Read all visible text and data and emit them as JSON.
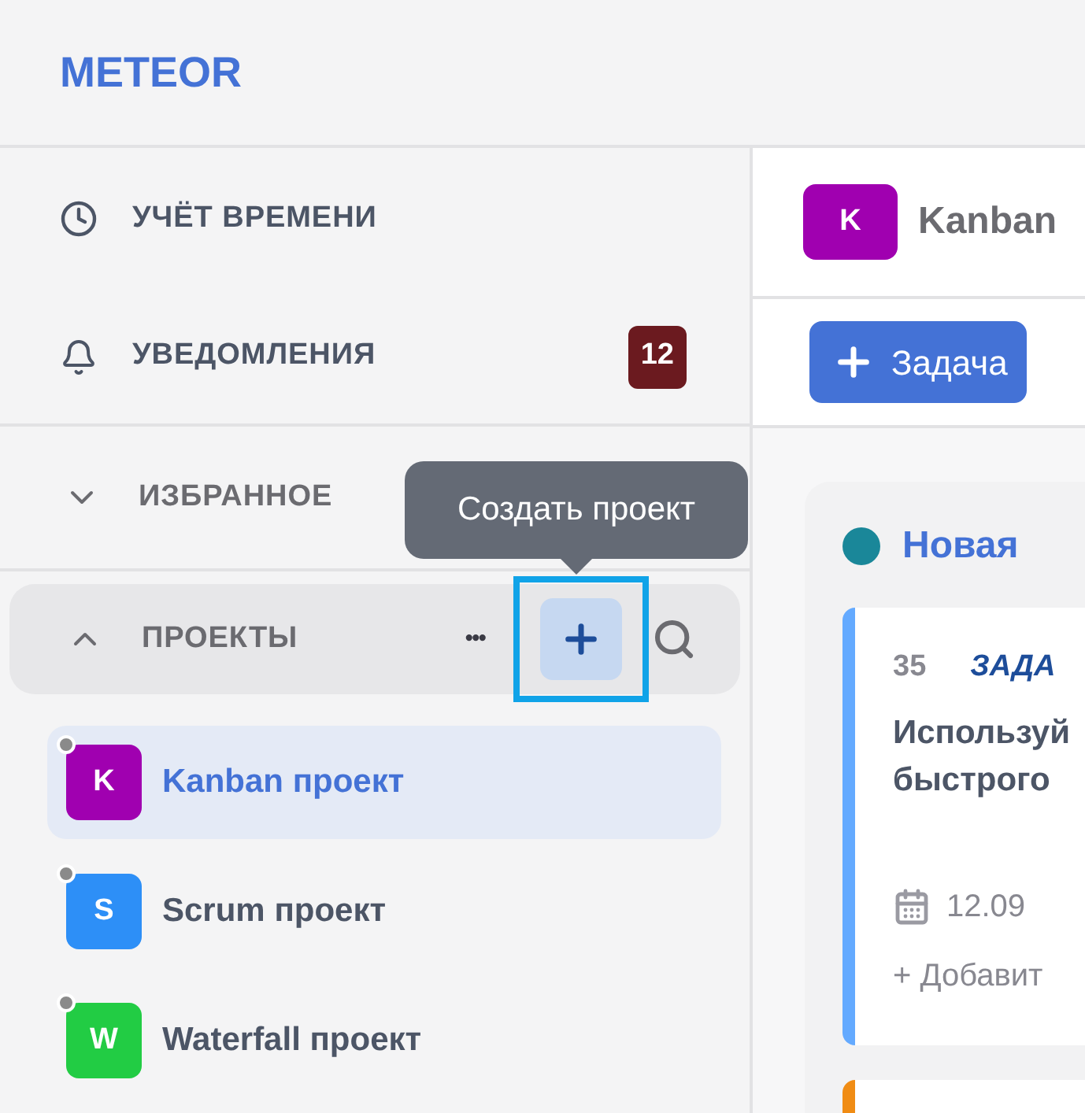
{
  "logo": "METEOR",
  "nav": [
    {
      "kind": "clock",
      "label": "УЧЁТ ВРЕМЕНИ"
    },
    {
      "kind": "bell",
      "label": "УВЕДОМЛЕНИЯ",
      "badge": "12"
    }
  ],
  "favorites": {
    "label": "ИЗБРАННОЕ",
    "expanded": false
  },
  "projects_section": {
    "label": "ПРОЕКТЫ",
    "expanded": true,
    "more": "•••",
    "add_highlighted": true,
    "tooltip": "Создать проект"
  },
  "projects": [
    {
      "initial": "K",
      "name": "Kanban проект",
      "color": "#a000b0",
      "selected": true
    },
    {
      "initial": "S",
      "name": "Scrum проект",
      "color": "#2d8ff7",
      "selected": false
    },
    {
      "initial": "W",
      "name": "Waterfall проект",
      "color": "#22cc44",
      "selected": false
    }
  ],
  "project_header": {
    "initial": "K",
    "title": "Kanban",
    "color": "#a000b0"
  },
  "toolbar": {
    "new_task": "Задача"
  },
  "board": {
    "column": {
      "title": "Новая",
      "color": "#1a8799",
      "cards": [
        {
          "number": "35",
          "type": "ЗАДА",
          "title_lines": [
            "Используй",
            "быстрого"
          ],
          "date": "12.09",
          "add": "+ Добавит",
          "color": "#64aaff"
        },
        {
          "color": "#f08c14"
        }
      ]
    }
  }
}
